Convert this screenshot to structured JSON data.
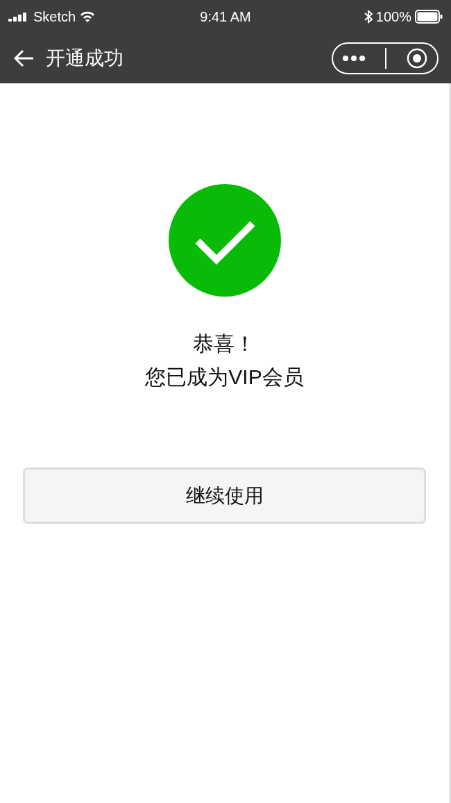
{
  "status_bar": {
    "carrier": "Sketch",
    "time": "9:41 AM",
    "battery": "100%"
  },
  "nav_bar": {
    "title": "开通成功"
  },
  "result": {
    "title": "恭喜！",
    "message": "您已成为VIP会员"
  },
  "buttons": [
    {
      "label": "继续使用"
    }
  ]
}
